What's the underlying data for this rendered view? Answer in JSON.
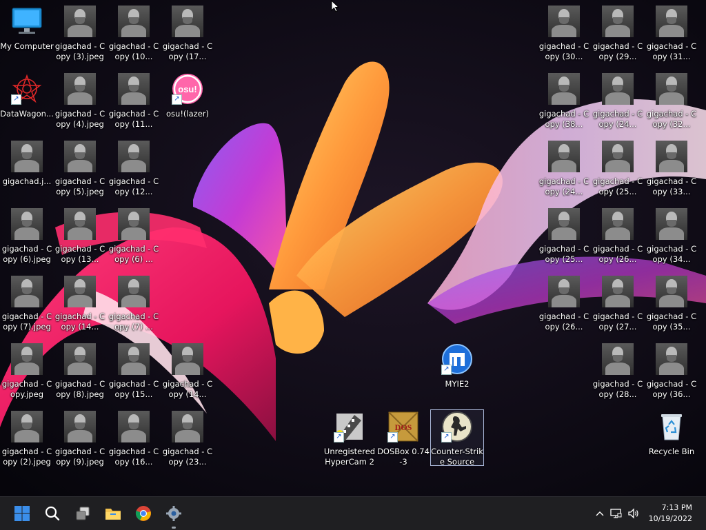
{
  "desktop": {
    "my_computer": "My Computer",
    "datawagon": "DataWagon...",
    "gigachad_single": "gigachad.j...",
    "osu_lazer": "osu!(lazer)",
    "osu_logo_text": "osu!",
    "gig_3": "gigachad - Copy (3).jpeg",
    "gig_10": "gigachad - Copy (10...",
    "gig_17": "gigachad - Copy (17...",
    "gig_4": "gigachad - Copy (4).jpeg",
    "gig_11": "gigachad - Copy (11...",
    "gig_5": "gigachad - Copy (5).jpeg",
    "gig_12": "gigachad - Copy (12...",
    "gig_6": "gigachad - Copy (6).jpeg",
    "gig_13": "gigachad - Copy (13...",
    "gig_6b": "gigachad - Copy (6) ...",
    "gig_7": "gigachad - Copy (7).jpeg",
    "gig_14": "gigachad - Copy (14...",
    "gig_7b": "gigachad - Copy (7) ...",
    "gig_copy": "gigachad - Copy.jpeg",
    "gig_8": "gigachad - Copy (8).jpeg",
    "gig_15": "gigachad - Copy (15...",
    "gig_14b": "gigachad - Copy (14...",
    "gig_2": "gigachad - Copy (2).jpeg",
    "gig_9": "gigachad - Copy (9).jpeg",
    "gig_16": "gigachad - Copy (16...",
    "gig_23": "gigachad - Copy (23...",
    "gig_30": "gigachad - Copy (30...",
    "gig_29": "gigachad - Copy (29...",
    "gig_31": "gigachad - Copy (31...",
    "gig_38": "gigachad - Copy (38...",
    "gig_24": "gigachad - Copy (24...",
    "gig_32": "gigachad - Copy (32...",
    "gig_24b": "gigachad - Copy (24...",
    "gig_25": "gigachad - Copy (25...",
    "gig_33": "gigachad - Copy (33...",
    "gig_25b": "gigachad - Copy (25...",
    "gig_26": "gigachad - Copy (26...",
    "gig_34": "gigachad - Copy (34...",
    "gig_26b": "gigachad - Copy (26...",
    "gig_27": "gigachad - Copy (27...",
    "gig_35": "gigachad - Copy (35...",
    "gig_28": "gigachad - Copy (28...",
    "gig_36": "gigachad - Copy (36...",
    "myie2": "MYIE2",
    "hypercam": "Unregistered HyperCam 2",
    "dosbox": "DOSBox 0.74-3",
    "dosbox_logo_text": "DOS",
    "css": "Counter-Strike Source",
    "recycle": "Recycle Bin"
  },
  "taskbar": {
    "time": "7:13 PM",
    "date": "10/19/2022"
  },
  "colors": {
    "taskbar_bg": "#1f1f22",
    "start_blue": "#3b8eea",
    "folder_yellow": "#f2c14e"
  },
  "icons": {
    "start": "windows-start-icon",
    "search": "search-icon",
    "task_view": "task-view-icon",
    "explorer": "file-explorer-icon",
    "chrome": "chrome-icon",
    "settings": "settings-gear-icon",
    "tray_up": "chevron-up-icon",
    "network": "network-icon",
    "volume": "volume-icon"
  }
}
